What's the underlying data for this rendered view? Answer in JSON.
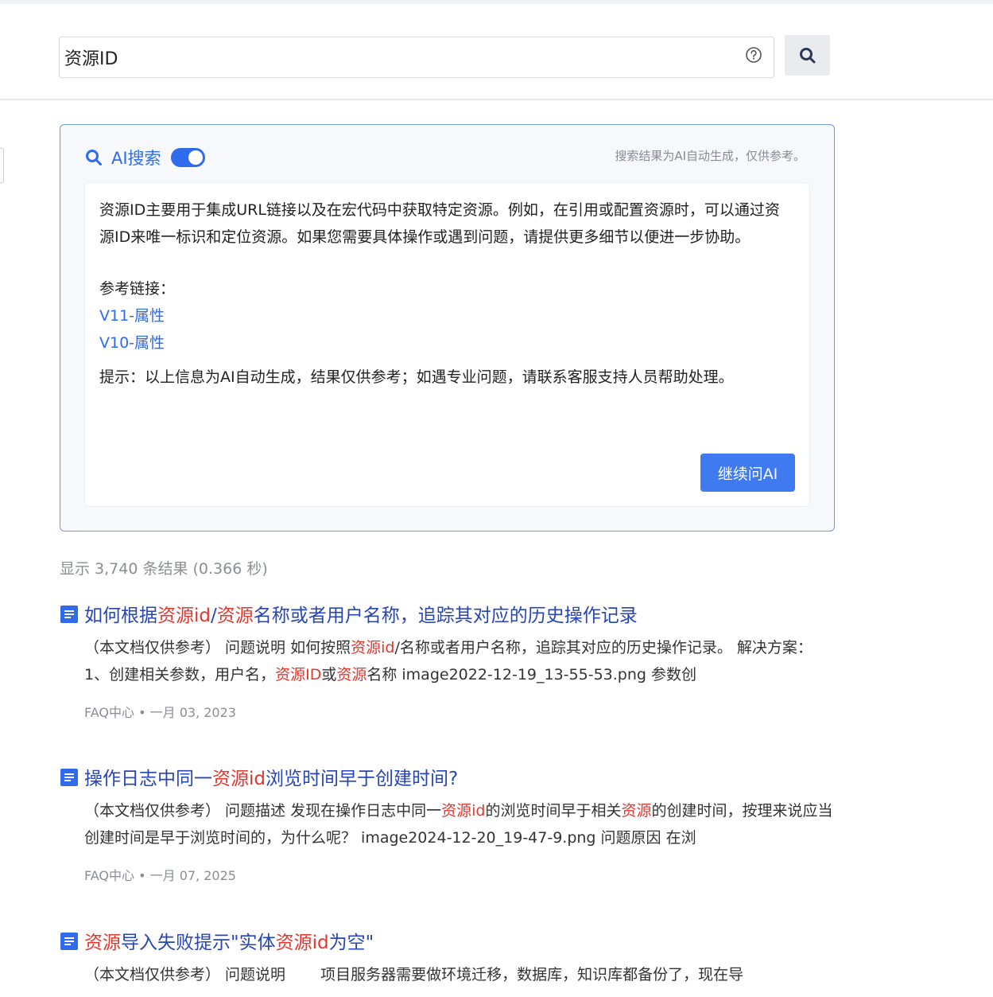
{
  "search": {
    "value": "资源ID",
    "help_icon": "question-circle-icon",
    "button_icon": "search-icon"
  },
  "ai": {
    "title": "AI搜索",
    "toggle_on": true,
    "note": "搜索结果为AI自动生成，仅供参考。",
    "answer": "资源ID主要用于集成URL链接以及在宏代码中获取特定资源。例如，在引用或配置资源时，可以通过资源ID来唯一标识和定位资源。如果您需要具体操作或遇到问题，请提供更多细节以便进一步协助。",
    "ref_title": "参考链接：",
    "links": [
      "V11-属性",
      "V10-属性"
    ],
    "tip": "提示：以上信息为AI自动生成，结果仅供参考；如遇专业问题，请联系客服支持人员帮助处理。",
    "continue_label": "继续问AI"
  },
  "results_summary": "显示 3,740 条结果 (0.366 秒)",
  "results": [
    {
      "title_parts": [
        {
          "t": "如何根据",
          "h": false
        },
        {
          "t": "资源id",
          "h": true
        },
        {
          "t": "/",
          "h": false
        },
        {
          "t": "资源",
          "h": true
        },
        {
          "t": "名称或者用户名称，追踪其对应的历史操作记录",
          "h": false
        }
      ],
      "snippet_parts": [
        {
          "t": "（本文档仅供参考） 问题说明 如何按照",
          "h": false
        },
        {
          "t": "资源id",
          "h": true
        },
        {
          "t": "/名称或者用户名称，追踪其对应的历史操作记录。 解决方案： 1、创建相关参数，用户名，",
          "h": false
        },
        {
          "t": "资源ID",
          "h": true
        },
        {
          "t": "或",
          "h": false
        },
        {
          "t": "资源",
          "h": true
        },
        {
          "t": "名称 image2022-12-19_13-55-53.png 参数创",
          "h": false
        }
      ],
      "meta": "FAQ中心 • 一月 03, 2023"
    },
    {
      "title_parts": [
        {
          "t": "操作日志中同一",
          "h": false
        },
        {
          "t": "资源id",
          "h": true
        },
        {
          "t": "浏览时间早于创建时间?",
          "h": false
        }
      ],
      "snippet_parts": [
        {
          "t": "（本文档仅供参考） 问题描述 发现在操作日志中同一",
          "h": false
        },
        {
          "t": "资源id",
          "h": true
        },
        {
          "t": "的浏览时间早于相关",
          "h": false
        },
        {
          "t": "资源",
          "h": true
        },
        {
          "t": "的创建时间，按理来说应当创建时间是早于浏览时间的，为什么呢？ image2024-12-20_19-47-9.png 问题原因 在浏",
          "h": false
        }
      ],
      "meta": "FAQ中心 • 一月 07, 2025"
    },
    {
      "title_parts": [
        {
          "t": "资源",
          "h": true
        },
        {
          "t": "导入失败提示\"实体",
          "h": false
        },
        {
          "t": "资源id",
          "h": true
        },
        {
          "t": "为空\"",
          "h": false
        }
      ],
      "snippet_parts": [
        {
          "t": "（本文档仅供参考） 问题说明 　　项目服务器需要做环境迁移，数据库，知识库都备份了，现在导",
          "h": false
        }
      ],
      "meta": ""
    }
  ],
  "result_icon": "document-icon"
}
